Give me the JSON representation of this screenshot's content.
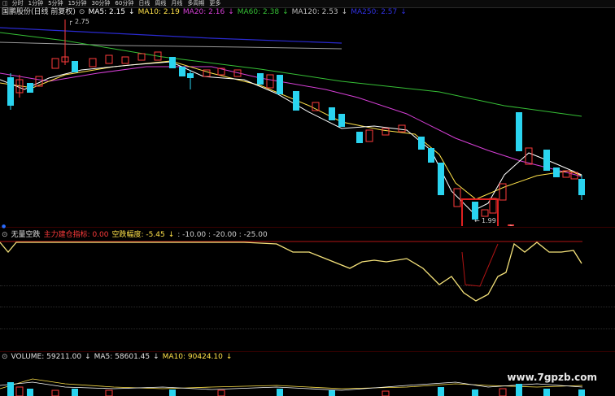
{
  "toolbar": {
    "items": [
      "分时",
      "1分钟",
      "5分钟",
      "15分钟",
      "30分钟",
      "60分钟",
      "日线",
      "周线",
      "月线",
      "多周期",
      "更多"
    ]
  },
  "main_header": {
    "stock": "国鹏股份(日线 前复权)",
    "ma5": "MA5: 2.15",
    "ma10": "MA10: 2.19",
    "ma20": "MA20: 2.16",
    "ma60": "MA60: 2.38",
    "ma120": "MA120: 2.53",
    "ma250": "MA250: 2.57"
  },
  "price_labels": {
    "high": "2.75",
    "low": "1.99"
  },
  "indicator_header": {
    "name": "无量空跌",
    "param1": "主力建仓指标: 0.00",
    "param2": "空跌幅度: -5.45",
    "levels": ": -10.00 : -20.00 : -25.00"
  },
  "volume_header": {
    "volume": "VOLUME: 59211.00",
    "ma5": "MA5: 58601.45",
    "ma10": "MA10: 90424.10"
  },
  "watermark": "www.7gpzb.com",
  "colors": {
    "up": "#ff3b3b",
    "down": "#2ad4f0",
    "ma5": "#ffffff",
    "ma10": "#ffe24a",
    "ma20": "#d63fd6",
    "ma60": "#36c036",
    "ma120": "#9a9a9a",
    "ma250": "#2a2ad0"
  }
}
